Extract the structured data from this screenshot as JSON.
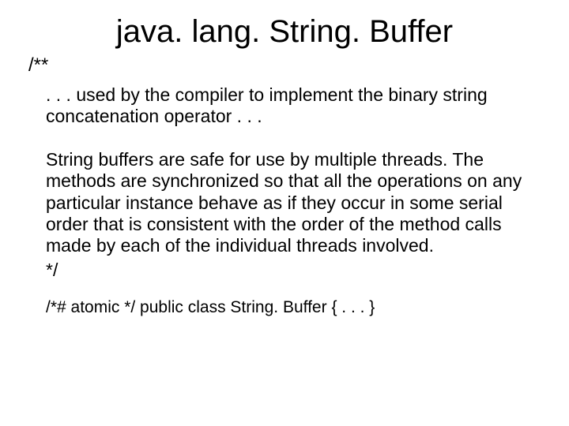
{
  "title": "java. lang. String. Buffer",
  "comment_open": "/**",
  "para1": ". . . used by the compiler to implement the binary string concatenation operator . . .",
  "para2": "String buffers are safe for use by multiple threads. The methods are synchronized so that all the operations on any particular instance behave as if they occur in some serial order that is consistent with the order of the method calls made by each of the individual threads involved.",
  "comment_close": "*/",
  "code_line": "/*# atomic */ public class String. Buffer { . . . }"
}
